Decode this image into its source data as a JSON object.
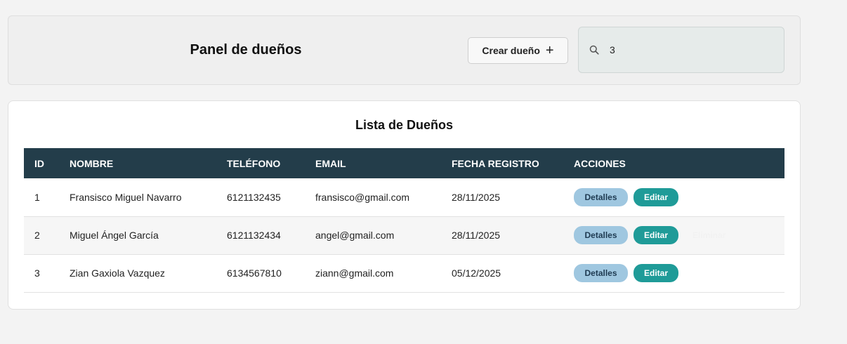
{
  "header": {
    "title": "Panel de dueños",
    "create_label": "Crear dueño",
    "create_icon": "plus-icon",
    "search": {
      "icon": "search-icon",
      "value": "3",
      "placeholder": ""
    }
  },
  "list": {
    "title": "Lista de Dueños",
    "columns": [
      "ID",
      "NOMBRE",
      "TELÉFONO",
      "EMAIL",
      "FECHA REGISTRO",
      "ACCIONES"
    ],
    "action_labels": {
      "details": "Detalles",
      "edit": "Editar",
      "delete": "Eliminar"
    },
    "rows": [
      {
        "id": "1",
        "name": "Fransisco Miguel Navarro",
        "phone": "6121132435",
        "email": "fransisco@gmail.com",
        "date": "28/11/2025",
        "show_delete": false
      },
      {
        "id": "2",
        "name": "Miguel Ángel García",
        "phone": "6121132434",
        "email": "angel@gmail.com",
        "date": "28/11/2025",
        "show_delete": true
      },
      {
        "id": "3",
        "name": "Zian Gaxiola Vazquez",
        "phone": "6134567810",
        "email": "ziann@gmail.com",
        "date": "05/12/2025",
        "show_delete": false
      }
    ]
  },
  "colors": {
    "table_header": "#233d4a",
    "details_button": "#9fc7e0",
    "edit_button": "#1f9b98",
    "search_bg": "#e6ebea"
  }
}
